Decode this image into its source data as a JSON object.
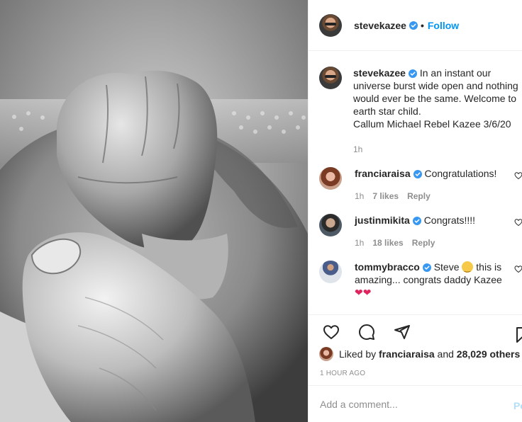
{
  "post": {
    "photo_alt": "Black and white photo of a baby's hand gripping an adult's thumb"
  },
  "header": {
    "username": "stevekazee",
    "dot": "•",
    "follow_label": "Follow"
  },
  "caption": {
    "username": "stevekazee",
    "text": "In an instant our universe burst wide open and nothing would ever be the same. Welcome to earth star child.",
    "signature": "Callum Michael Rebel Kazee 3/6/20",
    "time": "1h"
  },
  "comments": [
    {
      "username": "franciaraisa",
      "text": "Congratulations!",
      "time": "1h",
      "likes": "7 likes",
      "reply": "Reply"
    },
    {
      "username": "justinmikita",
      "text": "Congrats!!!!",
      "time": "1h",
      "likes": "18 likes",
      "reply": "Reply"
    },
    {
      "username": "tommybracco",
      "text_before": "Steve",
      "text_after": "this is amazing... congrats daddy Kazee",
      "hearts": "❤❤"
    }
  ],
  "liked_by": {
    "prefix": "Liked by",
    "user": "franciaraisa",
    "and": "and",
    "others": "28,029 others"
  },
  "timestamp": "1 HOUR AGO",
  "add_comment": {
    "placeholder": "Add a comment...",
    "post_label": "Post"
  },
  "colors": {
    "accent": "#0095f6",
    "verified": "#3897f0",
    "border": "#efefef",
    "muted": "#8e8e8e"
  },
  "icons": [
    "verified-badge-icon",
    "heart-icon",
    "comment-icon",
    "share-icon",
    "bookmark-icon",
    "small-heart-icon"
  ]
}
